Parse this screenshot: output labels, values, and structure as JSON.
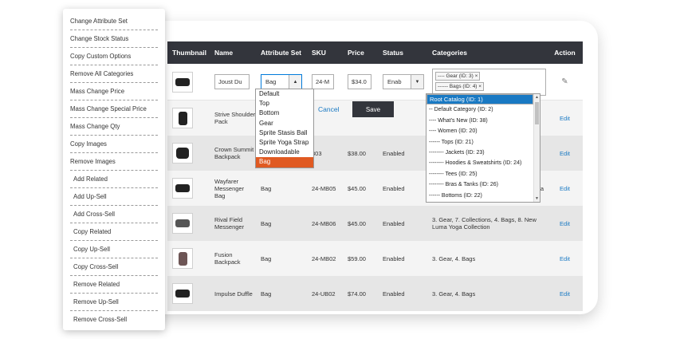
{
  "menu": {
    "items": [
      "Change Attribute Set",
      "Change Stock Status",
      "Copy Custom Options",
      "Remove All Categories",
      "Mass Change Price",
      "Mass Change Special Price",
      "Mass Change Qty",
      "Copy Images",
      "Remove Images",
      "Add Related",
      "Add Up-Sell",
      "Add Cross-Sell",
      "Copy Related",
      "Copy Up-Sell",
      "Copy Cross-Sell",
      "Remove Related",
      "Remove Up-Sell",
      "Remove Cross-Sell"
    ]
  },
  "grid": {
    "headers": {
      "thumbnail": "Thumbnail",
      "name": "Name",
      "attribute_set": "Attribute Set",
      "sku": "SKU",
      "price": "Price",
      "status": "Status",
      "categories": "Categories",
      "action": "Action"
    },
    "edit_row": {
      "name": "Joust Du",
      "attribute_set": "Bag",
      "sku": "24-M",
      "price": "$34.0",
      "status": "Enab",
      "category_tags": [
        "---- Gear (ID: 3) ×",
        "------ Bags (ID: 4) ×"
      ],
      "cancel_label": "Cancel",
      "save_label": "Save"
    },
    "rows": [
      {
        "name": "Strive Shoulder Pack",
        "attribute_set": "",
        "sku": "",
        "price": "",
        "status": "",
        "categories": "",
        "action": "Edit"
      },
      {
        "name": "Crown Summit Backpack",
        "attribute_set": "",
        "sku": "303",
        "price": "$38.00",
        "status": "Enabled",
        "categories": "",
        "action": "Edit"
      },
      {
        "name": "Wayfarer Messenger Bag",
        "attribute_set": "Bag",
        "sku": "24-MB05",
        "price": "$45.00",
        "status": "Enabled",
        "categories": "ma",
        "action": "Edit"
      },
      {
        "name": "Rival Field Messenger",
        "attribute_set": "Bag",
        "sku": "24-MB06",
        "price": "$45.00",
        "status": "Enabled",
        "categories": "3. Gear, 7. Collections, 4. Bags, 8. New Luma Yoga Collection",
        "action": "Edit"
      },
      {
        "name": "Fusion Backpack",
        "attribute_set": "Bag",
        "sku": "24-MB02",
        "price": "$59.00",
        "status": "Enabled",
        "categories": "3. Gear, 4. Bags",
        "action": "Edit"
      },
      {
        "name": "Impulse Duffle",
        "attribute_set": "Bag",
        "sku": "24-UB02",
        "price": "$74.00",
        "status": "Enabled",
        "categories": "3. Gear, 4. Bags",
        "action": "Edit"
      }
    ]
  },
  "attribute_dropdown": {
    "options": [
      "Default",
      "Top",
      "Bottom",
      "Gear",
      "Sprite Stasis Ball",
      "Sprite Yoga Strap",
      "Downloadable",
      "Bag"
    ],
    "selected": "Bag"
  },
  "category_dropdown": {
    "options": [
      "Root Catalog (ID: 1)",
      "-- Default Category (ID: 2)",
      "---- What's New (ID: 38)",
      "---- Women (ID: 20)",
      "------ Tops (ID: 21)",
      "-------- Jackets (ID: 23)",
      "-------- Hoodies & Sweatshirts (ID: 24)",
      "-------- Tees (ID: 25)",
      "-------- Bras & Tanks (ID: 26)",
      "------ Bottoms (ID: 22)"
    ],
    "selected": "Root Catalog (ID: 1)"
  },
  "colors": {
    "header_bg": "#33353c",
    "accent_orange": "#e05a22",
    "link_blue": "#1979c3"
  }
}
